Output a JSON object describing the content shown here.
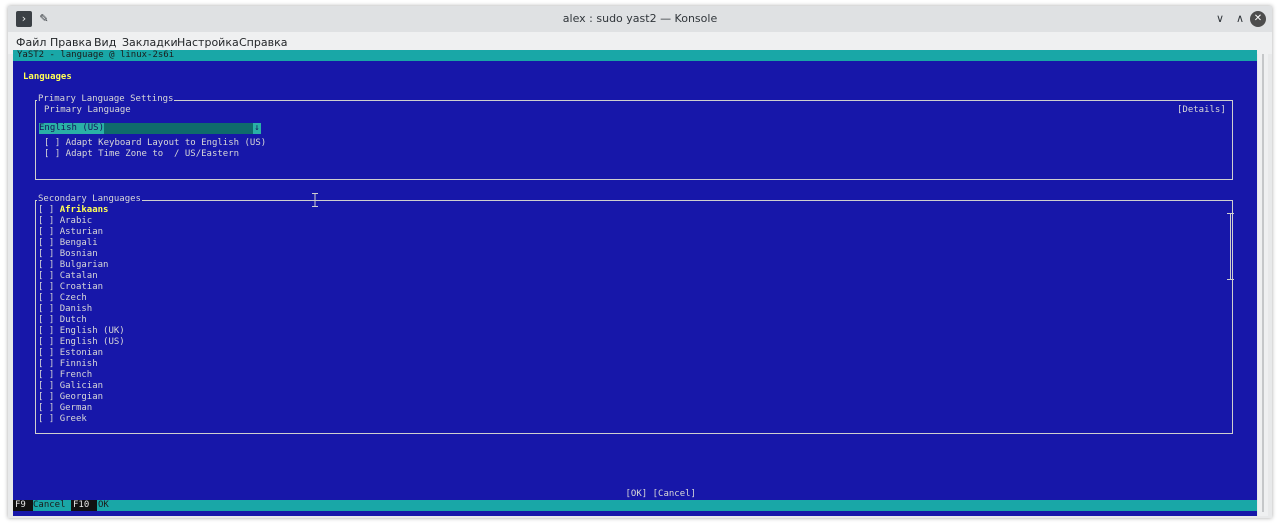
{
  "window": {
    "title": "alex : sudo yast2 — Konsole",
    "menu": [
      "Файл",
      "Правка",
      "Вид",
      "Закладки",
      "Настройка",
      "Справка"
    ]
  },
  "yast": {
    "header": "YaST2 - language @ linux-2s6i",
    "page_title": "Languages",
    "primary": {
      "legend": "Primary Language Settings",
      "label": "Primary Language",
      "selected": "English (US)",
      "details_button": "[Details]",
      "adapt_keyboard": "[ ] Adapt Keyboard Layout to English (US)",
      "adapt_timezone": "[ ] Adapt Time Zone to  / US/Eastern"
    },
    "secondary": {
      "legend": "Secondary Languages",
      "items": [
        "Afrikaans",
        "Arabic",
        "Asturian",
        "Bengali",
        "Bosnian",
        "Bulgarian",
        "Catalan",
        "Croatian",
        "Czech",
        "Danish",
        "Dutch",
        "English (UK)",
        "English (US)",
        "Estonian",
        "Finnish",
        "French",
        "Galician",
        "Georgian",
        "German",
        "Greek"
      ]
    },
    "buttons": {
      "ok": "[OK]",
      "cancel": "[Cancel]"
    },
    "fkeys": [
      {
        "key": "F9",
        "label": "Cancel"
      },
      {
        "key": "F10",
        "label": "OK"
      }
    ]
  },
  "colors": {
    "background": "#1717a9",
    "accent": "#19a7a7",
    "hotkey": "#ffff55"
  },
  "icons": {
    "app": "konsole-icon",
    "pin": "pin-icon",
    "minimize": "chevron-down-icon",
    "maximize": "chevron-up-icon",
    "close": "close-icon",
    "text_cursor": "ibeam-cursor-icon"
  }
}
